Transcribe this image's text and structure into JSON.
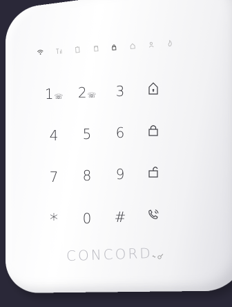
{
  "device": {
    "brand": "CONCORD",
    "panel_color": "#ffffff",
    "background_color": "#2a2838"
  },
  "status_icons": [
    {
      "name": "wifi-icon"
    },
    {
      "name": "signal-icon"
    },
    {
      "name": "battery-icon"
    },
    {
      "name": "door-icon"
    },
    {
      "name": "lock-closed-icon"
    },
    {
      "name": "home-icon"
    },
    {
      "name": "person-icon"
    },
    {
      "name": "fire-icon"
    }
  ],
  "keys": [
    {
      "label": "1",
      "sub": "☏"
    },
    {
      "label": "2",
      "sub": "☏"
    },
    {
      "label": "3",
      "sub": ""
    },
    {
      "label": "",
      "sub": "",
      "icon": "home-lock-icon"
    },
    {
      "label": "4",
      "sub": ""
    },
    {
      "label": "5",
      "sub": ""
    },
    {
      "label": "6",
      "sub": ""
    },
    {
      "label": "",
      "sub": "",
      "icon": "unlock-icon"
    },
    {
      "label": "7",
      "sub": ""
    },
    {
      "label": "8",
      "sub": ""
    },
    {
      "label": "9",
      "sub": ""
    },
    {
      "label": "",
      "sub": "",
      "icon": "unlock-open-icon"
    },
    {
      "label": "*",
      "sub": ""
    },
    {
      "label": "0",
      "sub": ""
    },
    {
      "label": "#",
      "sub": ""
    },
    {
      "label": "",
      "sub": "",
      "icon": "phone-call-icon"
    }
  ]
}
